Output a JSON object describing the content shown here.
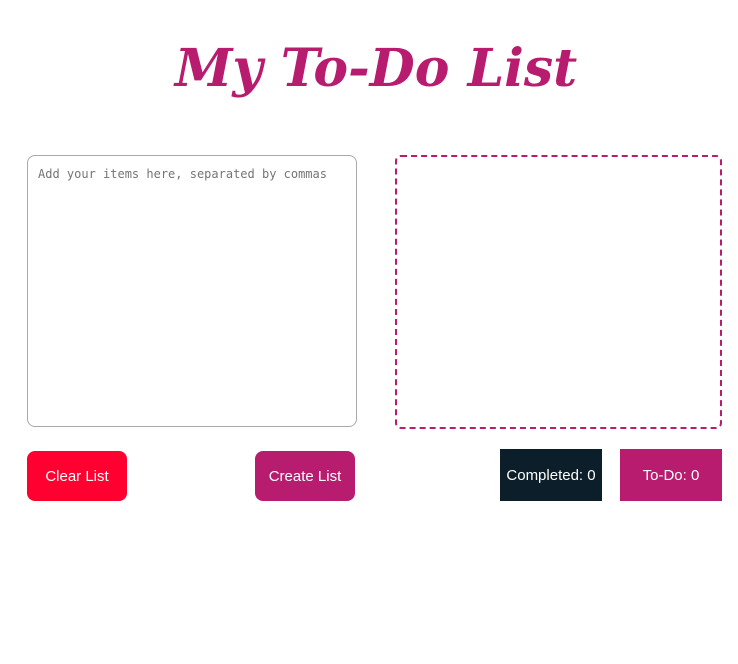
{
  "header": {
    "title": "My To-Do List"
  },
  "input": {
    "value": "",
    "placeholder": "Add your items here, separated by commas"
  },
  "list": {
    "items": []
  },
  "buttons": {
    "clear_label": "Clear List",
    "create_label": "Create List"
  },
  "counters": {
    "completed_label": "Completed: 0",
    "todo_label": "To-Do: 0"
  },
  "colors": {
    "brand": "#b71c6e",
    "clear_button": "#ff0030",
    "completed_badge": "#0b1e2a",
    "background": "#ffffff"
  }
}
